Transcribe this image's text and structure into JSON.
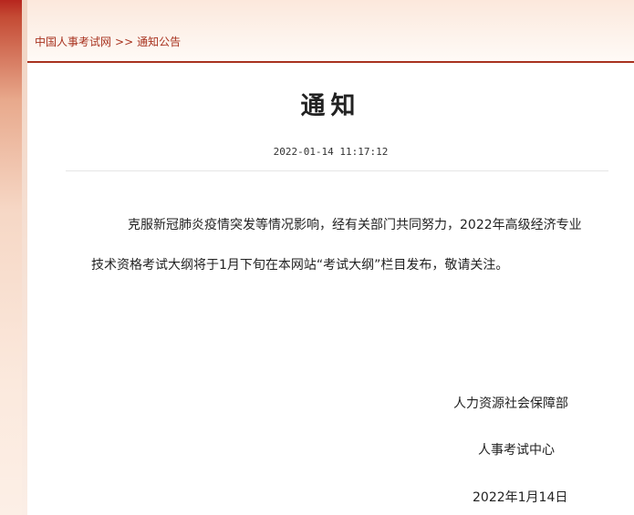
{
  "breadcrumb": {
    "home": "中国人事考试网",
    "separator": ">>",
    "current": "通知公告"
  },
  "article": {
    "title": "通知",
    "timestamp": "2022-01-14 11:17:12",
    "paragraph_line1": "克服新冠肺炎疫情突发等情况影响，经有关部门共同努力，2022年高级经济专业",
    "paragraph_line2": "技术资格考试大纲将于1月下旬在本网站“考试大纲”栏目发布，敬请关注。"
  },
  "signature": {
    "department": "人力资源社会保障部",
    "center": "人事考试中心",
    "date": "2022年1月14日"
  },
  "colors": {
    "accent": "#a8321f",
    "header_bg": "#fce8dc",
    "side_strip": "#b7261e"
  }
}
